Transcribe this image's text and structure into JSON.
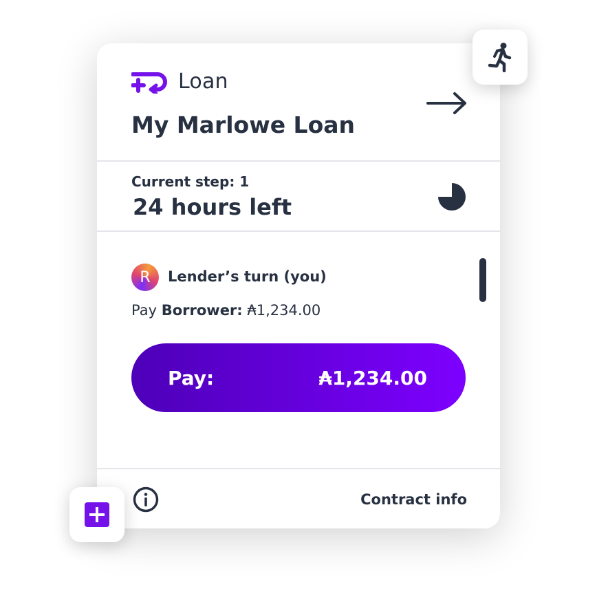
{
  "header": {
    "type_label": "Loan",
    "title": "My Marlowe Loan",
    "open_icon": "arrow-right-icon"
  },
  "status": {
    "step_label": "Current step: 1",
    "time_left": "24 hours left",
    "timer_icon": "pie-timer-icon"
  },
  "turn": {
    "avatar_initial": "R",
    "label": "Lender’s turn (you)",
    "pay_prefix": "Pay",
    "pay_party": "Borrower:",
    "pay_amount": "₳1,234.00"
  },
  "pay_button": {
    "label": "Pay:",
    "amount": "₳1,234.00"
  },
  "footer": {
    "info_icon": "info-icon",
    "contract_info_label": "Contract info"
  },
  "floating": {
    "top_right_icon": "running-person-icon",
    "bottom_left_icon": "plus-icon"
  },
  "colors": {
    "text": "#283142",
    "accent": "#7512ea",
    "button_gradient_start": "#4d00b8",
    "button_gradient_end": "#7d00ff"
  }
}
